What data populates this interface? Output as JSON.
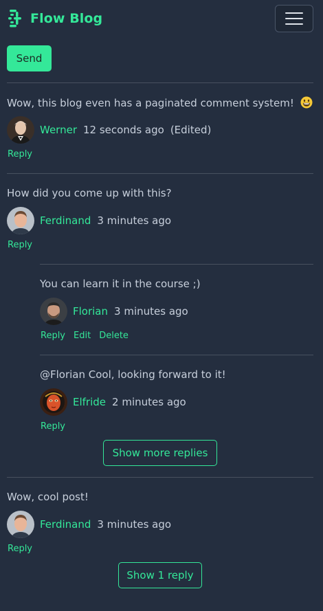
{
  "header": {
    "brand": "Flow Blog",
    "logo_icon": "flow-logo-icon",
    "menu_icon": "hamburger-menu-icon"
  },
  "composer": {
    "send_label": "Send"
  },
  "colors": {
    "accent": "#34e899",
    "background": "#242e3f",
    "text": "#c7cfdb",
    "divider": "#48515f"
  },
  "comments": [
    {
      "text": "Wow, this blog even has a paginated comment system!",
      "emoji": "grinning-face-emoji",
      "author": "Werner",
      "time": "12 seconds ago",
      "edited": "(Edited)",
      "actions": [
        "Reply"
      ]
    },
    {
      "text": "How did you come up with this?",
      "author": "Ferdinand",
      "time": "3 minutes ago",
      "actions": [
        "Reply"
      ],
      "replies": [
        {
          "text": "You can learn it in the course ;)",
          "author": "Florian",
          "time": "3 minutes ago",
          "actions": [
            "Reply",
            "Edit",
            "Delete"
          ]
        },
        {
          "text": "@Florian Cool, looking forward to it!",
          "author": "Elfride",
          "time": "2 minutes ago",
          "actions": [
            "Reply"
          ]
        }
      ],
      "more_replies_label": "Show more replies"
    },
    {
      "text": "Wow, cool post!",
      "author": "Ferdinand",
      "time": "3 minutes ago",
      "actions": [
        "Reply"
      ],
      "show_replies_label": "Show 1 reply"
    }
  ]
}
